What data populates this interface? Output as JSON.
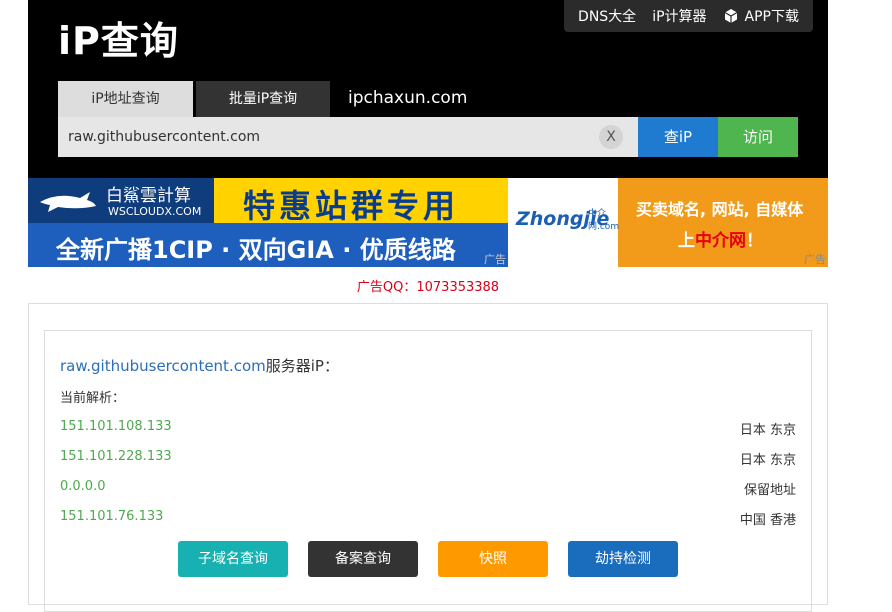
{
  "header": {
    "logo": "iP查询",
    "topnav": {
      "dns": "DNS大全",
      "calc": "iP计算器",
      "app": "APP下载"
    },
    "tabs": {
      "ip_lookup": "iP地址查询",
      "batch": "批量iP查询"
    },
    "domain": "ipchaxun.com"
  },
  "search": {
    "value": "raw.githubusercontent.com",
    "clear": "X",
    "query_label": "查iP",
    "visit_label": "访问"
  },
  "ads": {
    "left": {
      "brand_cn": "白鯊雲計算",
      "brand_en": "WSCLOUDX.COM",
      "slogan": "特惠站群专用",
      "line2": "全新广播1CIP · 双向GIA · 优质线路",
      "tag": "广告"
    },
    "right": {
      "logo": "Zhongjie",
      "logo_sub": "中介网.com",
      "line1": "买卖域名, 网站, 自媒体",
      "line2_pre": "上",
      "line2_hl": "中介网",
      "line2_post": "！",
      "tag": "广告"
    },
    "qq": "广告QQ：1073353388"
  },
  "result": {
    "domain": "raw.githubusercontent.com",
    "suffix": "服务器iP：",
    "current_label": "当前解析：",
    "rows": [
      {
        "ip": "151.101.108.133",
        "loc": "日本 东京"
      },
      {
        "ip": "151.101.228.133",
        "loc": "日本 东京"
      },
      {
        "ip": "0.0.0.0",
        "loc": "保留地址"
      },
      {
        "ip": "151.101.76.133",
        "loc": "中国 香港"
      }
    ],
    "buttons": {
      "subdomain": "子域名查询",
      "icp": "备案查询",
      "snapshot": "快照",
      "hijack": "劫持检测"
    }
  },
  "colors": {
    "query_btn": "#1e7bd0",
    "visit_btn": "#4fb54f",
    "subdomain_btn": "#17b1b1",
    "icp_btn": "#333333",
    "snapshot_btn": "#ff9900",
    "hijack_btn": "#1a6dbd",
    "ip_text": "#4ea94e"
  }
}
